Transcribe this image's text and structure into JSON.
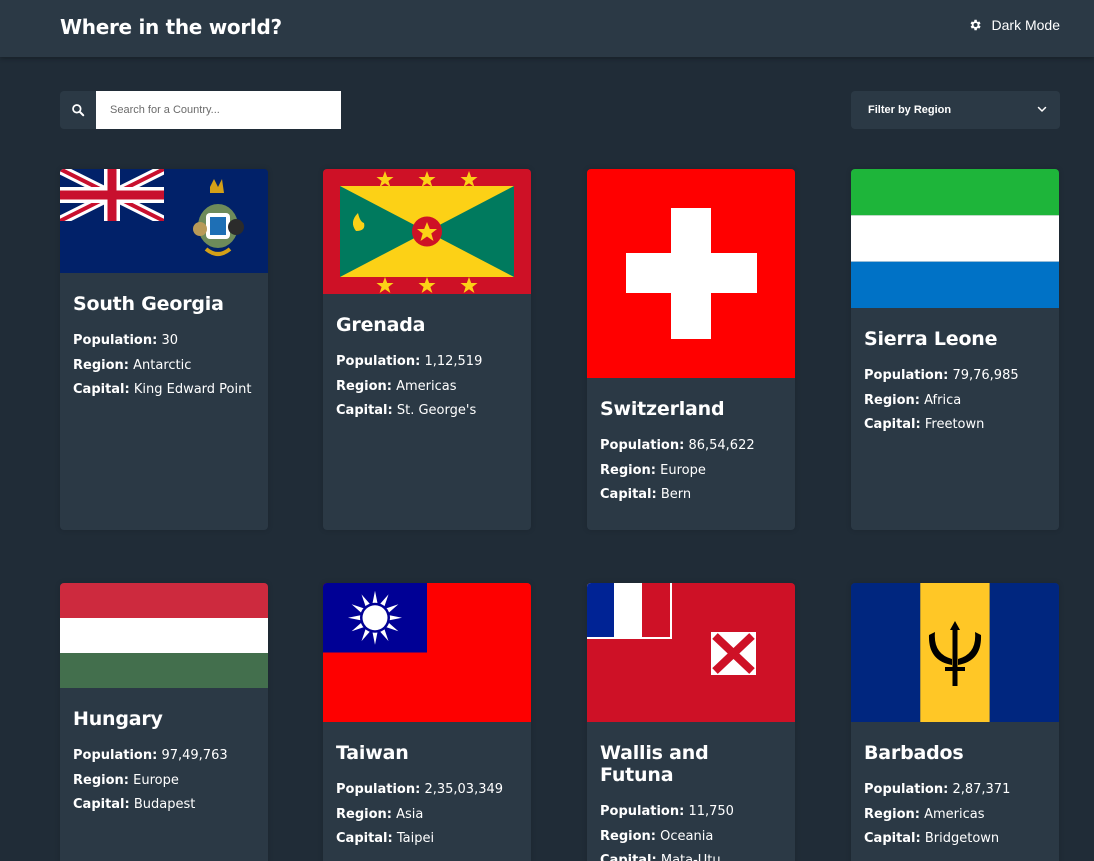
{
  "header": {
    "title": "Where in the world?",
    "mode_label": "Dark Mode",
    "mode_icon": "gear-icon"
  },
  "search": {
    "placeholder": "Search for a Country...",
    "icon": "search-icon"
  },
  "filter": {
    "label": "Filter by Region",
    "icon": "chevron-down-icon"
  },
  "labels": {
    "population": "Population:",
    "region": "Region:",
    "capital": "Capital:"
  },
  "countries": [
    {
      "name": "South Georgia",
      "population": "30",
      "region": "Antarctic",
      "capital": "King Edward Point"
    },
    {
      "name": "Grenada",
      "population": "1,12,519",
      "region": "Americas",
      "capital": "St. George's"
    },
    {
      "name": "Switzerland",
      "population": "86,54,622",
      "region": "Europe",
      "capital": "Bern"
    },
    {
      "name": "Sierra Leone",
      "population": "79,76,985",
      "region": "Africa",
      "capital": "Freetown"
    },
    {
      "name": "Hungary",
      "population": "97,49,763",
      "region": "Europe",
      "capital": "Budapest"
    },
    {
      "name": "Taiwan",
      "population": "2,35,03,349",
      "region": "Asia",
      "capital": "Taipei"
    },
    {
      "name": "Wallis and Futuna",
      "population": "11,750",
      "region": "Oceania",
      "capital": "Mata-Utu"
    },
    {
      "name": "Barbados",
      "population": "2,87,371",
      "region": "Americas",
      "capital": "Bridgetown"
    }
  ]
}
